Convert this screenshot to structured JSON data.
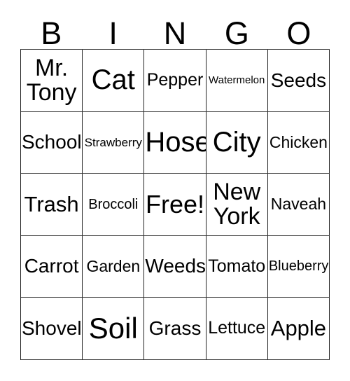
{
  "card": {
    "title": "BINGO",
    "headers": [
      {
        "letter": "B"
      },
      {
        "letter": "I"
      },
      {
        "letter": "N"
      },
      {
        "letter": "G"
      },
      {
        "letter": "O"
      }
    ],
    "free_space_label": "Free!",
    "colors": {
      "text": "#000000",
      "border": "#222222",
      "background": "#ffffff"
    },
    "rows": [
      [
        {
          "text": "Mr.\nTony",
          "size": "xxl"
        },
        {
          "text": "Cat",
          "size": "4xl"
        },
        {
          "text": "Pepper",
          "size": "ml"
        },
        {
          "text": "Watermelon",
          "size": "xs"
        },
        {
          "text": "Seeds",
          "size": "l"
        }
      ],
      [
        {
          "text": "School",
          "size": "l"
        },
        {
          "text": "Strawberry",
          "size": "s"
        },
        {
          "text": "Hose",
          "size": "4xl"
        },
        {
          "text": "City",
          "size": "4xl"
        },
        {
          "text": "Chicken",
          "size": "m"
        }
      ],
      [
        {
          "text": "Trash",
          "size": "xl"
        },
        {
          "text": "Broccoli",
          "size": "sm"
        },
        {
          "text": "Free!",
          "size": "3xl"
        },
        {
          "text": "New\nYork",
          "size": "xxl"
        },
        {
          "text": "Naveah",
          "size": "m"
        }
      ],
      [
        {
          "text": "Carrot",
          "size": "l"
        },
        {
          "text": "Garden",
          "size": "m"
        },
        {
          "text": "Weeds",
          "size": "l"
        },
        {
          "text": "Tomato",
          "size": "ml"
        },
        {
          "text": "Blueberry",
          "size": "sm"
        }
      ],
      [
        {
          "text": "Shovel",
          "size": "l"
        },
        {
          "text": "Soil",
          "size": "5xl"
        },
        {
          "text": "Grass",
          "size": "l"
        },
        {
          "text": "Lettuce",
          "size": "ml"
        },
        {
          "text": "Apple",
          "size": "xl"
        }
      ]
    ]
  }
}
